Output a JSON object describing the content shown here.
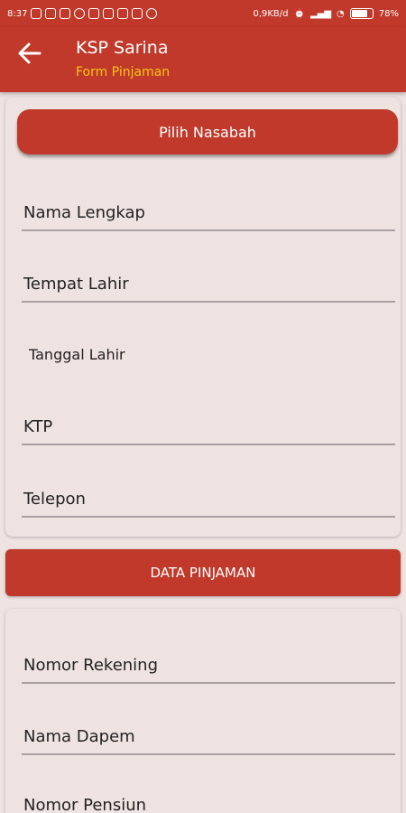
{
  "status_bar": {
    "time": "8:37",
    "network_speed": "0,9KB/d",
    "battery": "78%",
    "battery_level": 0.78
  },
  "app_bar": {
    "title": "KSP Sarina",
    "subtitle": "Form Pinjaman"
  },
  "nasabah_card": {
    "select_button_label": "Pilih Nasabah",
    "fields": {
      "nama_lengkap": "Nama Lengkap",
      "tempat_lahir": "Tempat Lahir",
      "tanggal_lahir": "Tanggal Lahir",
      "ktp": "KTP",
      "telepon": "Telepon"
    }
  },
  "pinjaman": {
    "section_title": "DATA PINJAMAN",
    "fields": {
      "nomor_rekening": "Nomor Rekening",
      "nama_dapem": "Nama Dapem",
      "nomor_pensiun": "Nomor Pensiun"
    }
  },
  "colors": {
    "primary": "#c0392b",
    "accent": "#f5c518",
    "background": "#efe3e2"
  }
}
